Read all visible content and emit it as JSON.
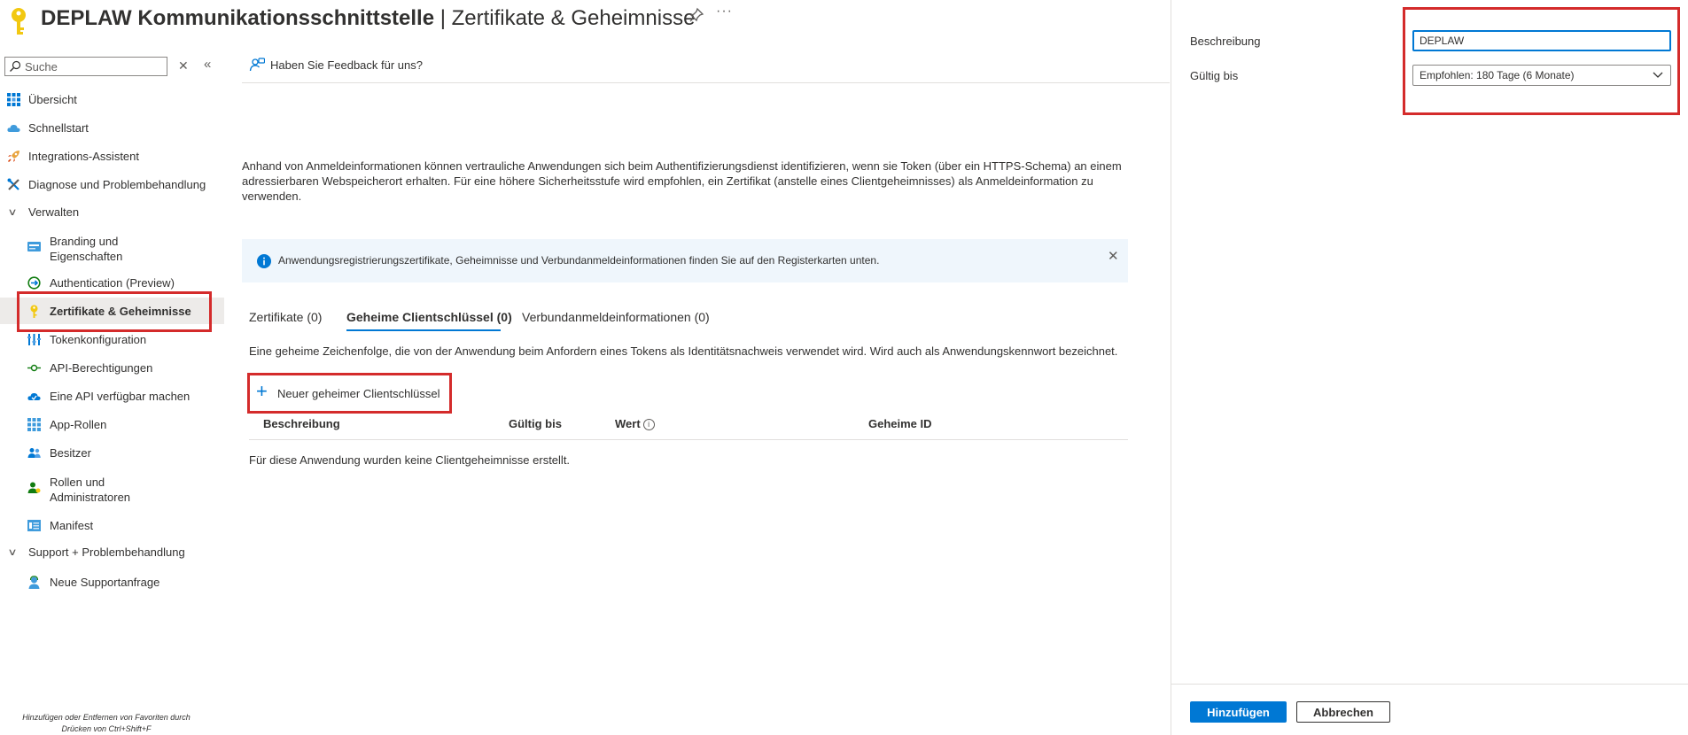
{
  "header": {
    "app_name": "DEPLAW Kommunikationsschnittstelle",
    "separator": " | ",
    "page_name": "Zertifikate & Geheimnisse",
    "more_label": "···"
  },
  "sidebar": {
    "search_placeholder": "Suche",
    "items": [
      {
        "label": "Übersicht",
        "icon": "grid-icon"
      },
      {
        "label": "Schnellstart",
        "icon": "cloud-icon"
      },
      {
        "label": "Integrations-Assistent",
        "icon": "rocket-icon"
      },
      {
        "label": "Diagnose und Problembehandlung",
        "icon": "wrench-icon"
      },
      {
        "label": "Verwalten",
        "icon": "chevron-down-icon"
      },
      {
        "label": "Branding und\nEigenschaften",
        "icon": "card-icon"
      },
      {
        "label": "Authentication (Preview)",
        "icon": "auth-icon"
      },
      {
        "label": "Zertifikate & Geheimnisse",
        "icon": "key-icon"
      },
      {
        "label": "Tokenkonfiguration",
        "icon": "bars-icon"
      },
      {
        "label": "API-Berechtigungen",
        "icon": "api-icon"
      },
      {
        "label": "Eine API verfügbar machen",
        "icon": "cloud-expose-icon"
      },
      {
        "label": "App-Rollen",
        "icon": "apps-icon"
      },
      {
        "label": "Besitzer",
        "icon": "people-icon"
      },
      {
        "label": "Rollen und\nAdministratoren",
        "icon": "admin-icon"
      },
      {
        "label": "Manifest",
        "icon": "manifest-icon"
      },
      {
        "label": "Support + Problembehandlung",
        "icon": "chevron-down-icon"
      },
      {
        "label": "Neue Supportanfrage",
        "icon": "support-icon"
      }
    ],
    "favorites_hint_line1": "Hinzufügen oder Entfernen von Favoriten durch",
    "favorites_hint_line2": "Drücken von Ctrl+Shift+F"
  },
  "main": {
    "feedback_label": "Haben Sie Feedback für uns?",
    "description": "Anhand von Anmeldeinformationen können vertrauliche Anwendungen sich beim Authentifizierungsdienst identifizieren, wenn sie Token (über ein HTTPS-Schema) an einem adressierbaren Webspeicherort erhalten. Für eine höhere Sicherheitsstufe wird empfohlen, ein Zertifikat (anstelle eines Clientgeheimnisses) als Anmeldeinformation zu verwenden.",
    "info_text": "Anwendungsregistrierungszertifikate, Geheimnisse und Verbundanmeldeinformationen finden Sie auf den Registerkarten unten.",
    "tabs": [
      {
        "label": "Zertifikate (0)"
      },
      {
        "label": "Geheime Clientschlüssel (0)"
      },
      {
        "label": "Verbundanmeldeinformationen (0)"
      }
    ],
    "secrets_description": "Eine geheime Zeichenfolge, die von der Anwendung beim Anfordern eines Tokens als Identitätsnachweis verwendet wird. Wird auch als Anwendungskennwort bezeichnet.",
    "add_secret_label": "Neuer geheimer Clientschlüssel",
    "table_headers": [
      "Beschreibung",
      "Gültig bis",
      "Wert",
      "Geheime ID"
    ],
    "empty_text": "Für diese Anwendung wurden keine Clientgeheimnisse erstellt."
  },
  "panel": {
    "description_label": "Beschreibung",
    "description_value": "DEPLAW",
    "expires_label": "Gültig bis",
    "expires_value": "Empfohlen: 180 Tage (6 Monate)",
    "add_button": "Hinzufügen",
    "cancel_button": "Abbrechen"
  },
  "colors": {
    "accent": "#0078d4",
    "highlight_box": "#d42b2b",
    "info_background": "#eff6fc",
    "selected_nav": "#edebe9"
  }
}
